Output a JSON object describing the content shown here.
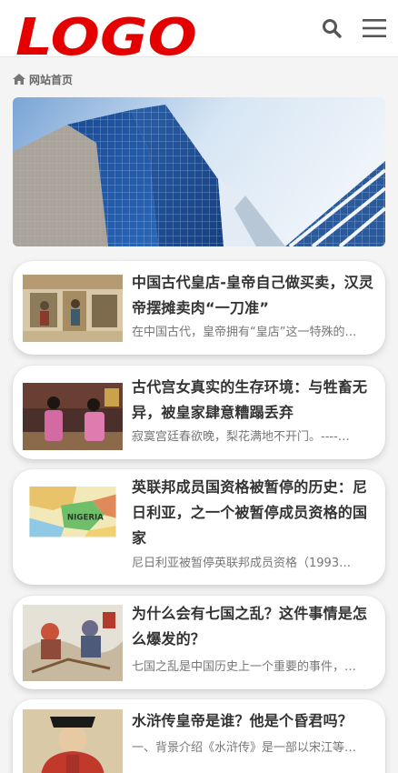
{
  "header": {
    "logo_text": "LOGO",
    "brand_color": "#e50000",
    "icons": [
      "search-icon",
      "menu-icon"
    ]
  },
  "breadcrumb": {
    "icon": "home-icon",
    "home_label": "网站首页"
  },
  "banner": {
    "image": "skyscraper-banner"
  },
  "articles": [
    {
      "title": "中国古代皇店-皇帝自己做买卖，汉灵帝摆摊卖肉“一刀准”",
      "summary": "在中国古代，皇帝拥有“皇店”这一特殊的…",
      "thumbnail": "ancient-painting-thumbnail"
    },
    {
      "title": "古代宫女真实的生存环境：与牲畜无异，被皇家肆意糟蹋丢弃",
      "summary": "寂寞宫廷春欲晚，梨花满地不开门。----…",
      "thumbnail": "palace-maids-thumbnail"
    },
    {
      "title": "英联邦成员国资格被暂停的历史：尼日利亚，之一个被暂停成员资格的国家",
      "summary": "尼日利亚被暂停英联邦成员资格（1993…",
      "thumbnail": "nigeria-map-thumbnail"
    },
    {
      "title": "为什么会有七国之乱？这件事情是怎么爆发的？",
      "summary": "七国之乱是中国历史上一个重要的事件，…",
      "thumbnail": "battle-painting-thumbnail"
    },
    {
      "title": "水浒传皇帝是谁？他是个昏君吗？",
      "summary": "一、背景介绍《水浒传》是一部以宋江等…",
      "thumbnail": "emperor-portrait-thumbnail"
    }
  ]
}
